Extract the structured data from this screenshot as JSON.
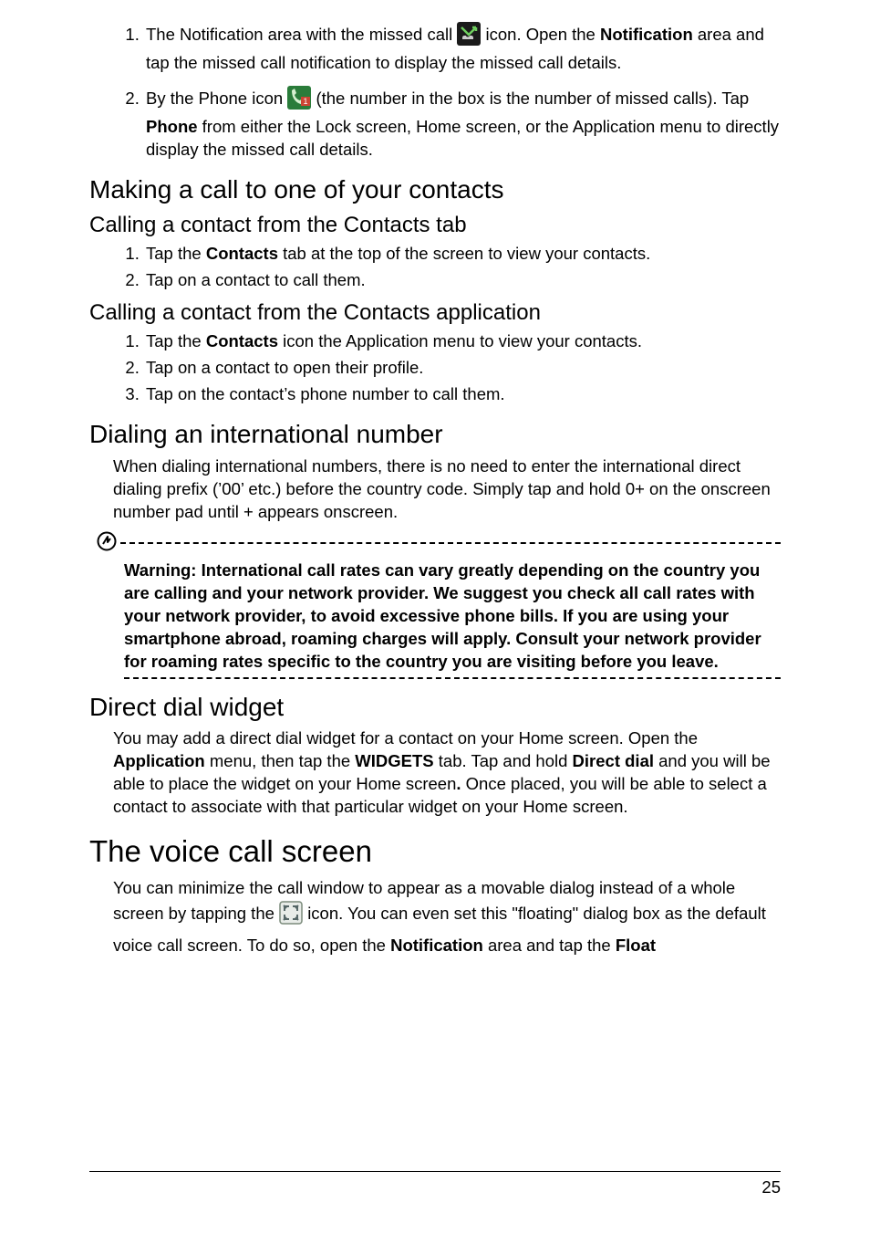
{
  "list1": {
    "item1_a": "The Notification area with the missed call ",
    "item1_b": " icon. Open the ",
    "item1_bold": "Notification",
    "item1_c": " area and tap the missed call notification to display the missed call details.",
    "item2_a": "By the Phone icon ",
    "item2_b": " (the number in the box is the number of missed calls). Tap ",
    "item2_bold": "Phone",
    "item2_c": " from either the Lock screen, Home screen, or the Application menu to directly display the missed call details."
  },
  "h2_contacts": "Making a call to one of your contacts",
  "h3_tab": "Calling a contact from the Contacts tab",
  "tab_list": {
    "i1_a": "Tap the ",
    "i1_bold": "Contacts",
    "i1_b": " tab at the top of the screen to view your contacts.",
    "i2": "Tap on a contact to call them."
  },
  "h3_app": "Calling a contact from the Contacts application",
  "app_list": {
    "i1_a": "Tap the ",
    "i1_bold": "Contacts",
    "i1_b": " icon the Application menu to view your contacts.",
    "i2": "Tap on a contact to open their profile.",
    "i3": "Tap on the contact’s phone number to call them."
  },
  "h2_intl": "Dialing an international number",
  "p_intl": "When dialing international numbers, there is no need to enter the international direct dialing prefix (’00’ etc.) before the country code. Simply tap and hold 0+ on the onscreen number pad until + appears onscreen.",
  "warning": "Warning: International call rates can vary greatly depending on the country you are calling and your network provider. We suggest you check all call rates with your network provider, to avoid excessive phone bills. If you are using your smartphone abroad, roaming charges will apply. Consult your network provider for roaming rates specific to the country you are visiting before you leave.",
  "h2_widget": "Direct dial widget",
  "p_widget_a": "You may add a direct dial widget for a contact on your Home screen. Open the ",
  "p_widget_b1": "Application",
  "p_widget_b": " menu, then tap the ",
  "p_widget_b2": "WIDGETS",
  "p_widget_c": " tab. Tap and hold ",
  "p_widget_b3": "Direct dial",
  "p_widget_d": " and you will be able to place the widget on your Home screen",
  "p_widget_dot": ".",
  "p_widget_e": " Once placed, you will be able to select a contact to associate with that particular widget on your Home screen.",
  "h1_voice": "The voice call screen",
  "p_voice_a": "You can minimize the call window to appear as a movable dialog instead of a whole screen by tapping the ",
  "p_voice_b": " icon. You can even set this \"floating\" dialog box as the default voice call screen. To do so, open the ",
  "p_voice_b1": "Notification",
  "p_voice_c": " area and tap the ",
  "p_voice_b2": "Float",
  "page_number": "25"
}
